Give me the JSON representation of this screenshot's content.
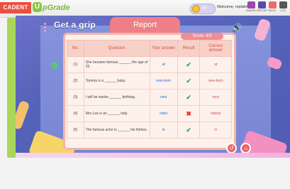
{
  "app": {
    "brand_left": "CADENT",
    "brand_right": "pGrade",
    "brand_right_initial": "U",
    "coins": "45",
    "welcome": "Welcome, mplab48"
  },
  "top_icons": [
    {
      "label": "AWARD",
      "color": "#9b4aa5"
    },
    {
      "label": "REPORT",
      "color": "#5b4aa5"
    },
    {
      "label": "BACK",
      "color": "#ef6b6b"
    },
    {
      "label": "LOG",
      "color": "#555"
    }
  ],
  "game": {
    "title": "Get a grip",
    "report_title": "Report",
    "score": "Score: 4/5"
  },
  "table": {
    "headers": [
      "No.",
      "Question",
      "Your answer",
      "Result",
      "Correct answer"
    ],
    "rows": [
      {
        "no": "(1)",
        "q": "She became famous ______ the age of 25.",
        "ans": "at",
        "ok": true,
        "correct": "at"
      },
      {
        "no": "(2)",
        "q": "Tommy is a ______ baby.",
        "ans": "new-born",
        "ok": true,
        "correct": "new-born"
      },
      {
        "no": "(3)",
        "q": "I will be twelve ______ birthday.",
        "ans": "next",
        "ok": true,
        "correct": "next"
      },
      {
        "no": "(4)",
        "q": "Mrs Lee is an ______ lady.",
        "ans": "older",
        "ok": false,
        "correct": "elderly"
      },
      {
        "no": "(5)",
        "q": "The famous actor is ______ his thirties.",
        "ans": "in",
        "ok": true,
        "correct": "in"
      }
    ]
  },
  "colors": {
    "accent": "#ef7f86",
    "correct": "#3caa4a",
    "wrong": "#e53232",
    "answer_blue": "#2a6fd0"
  }
}
